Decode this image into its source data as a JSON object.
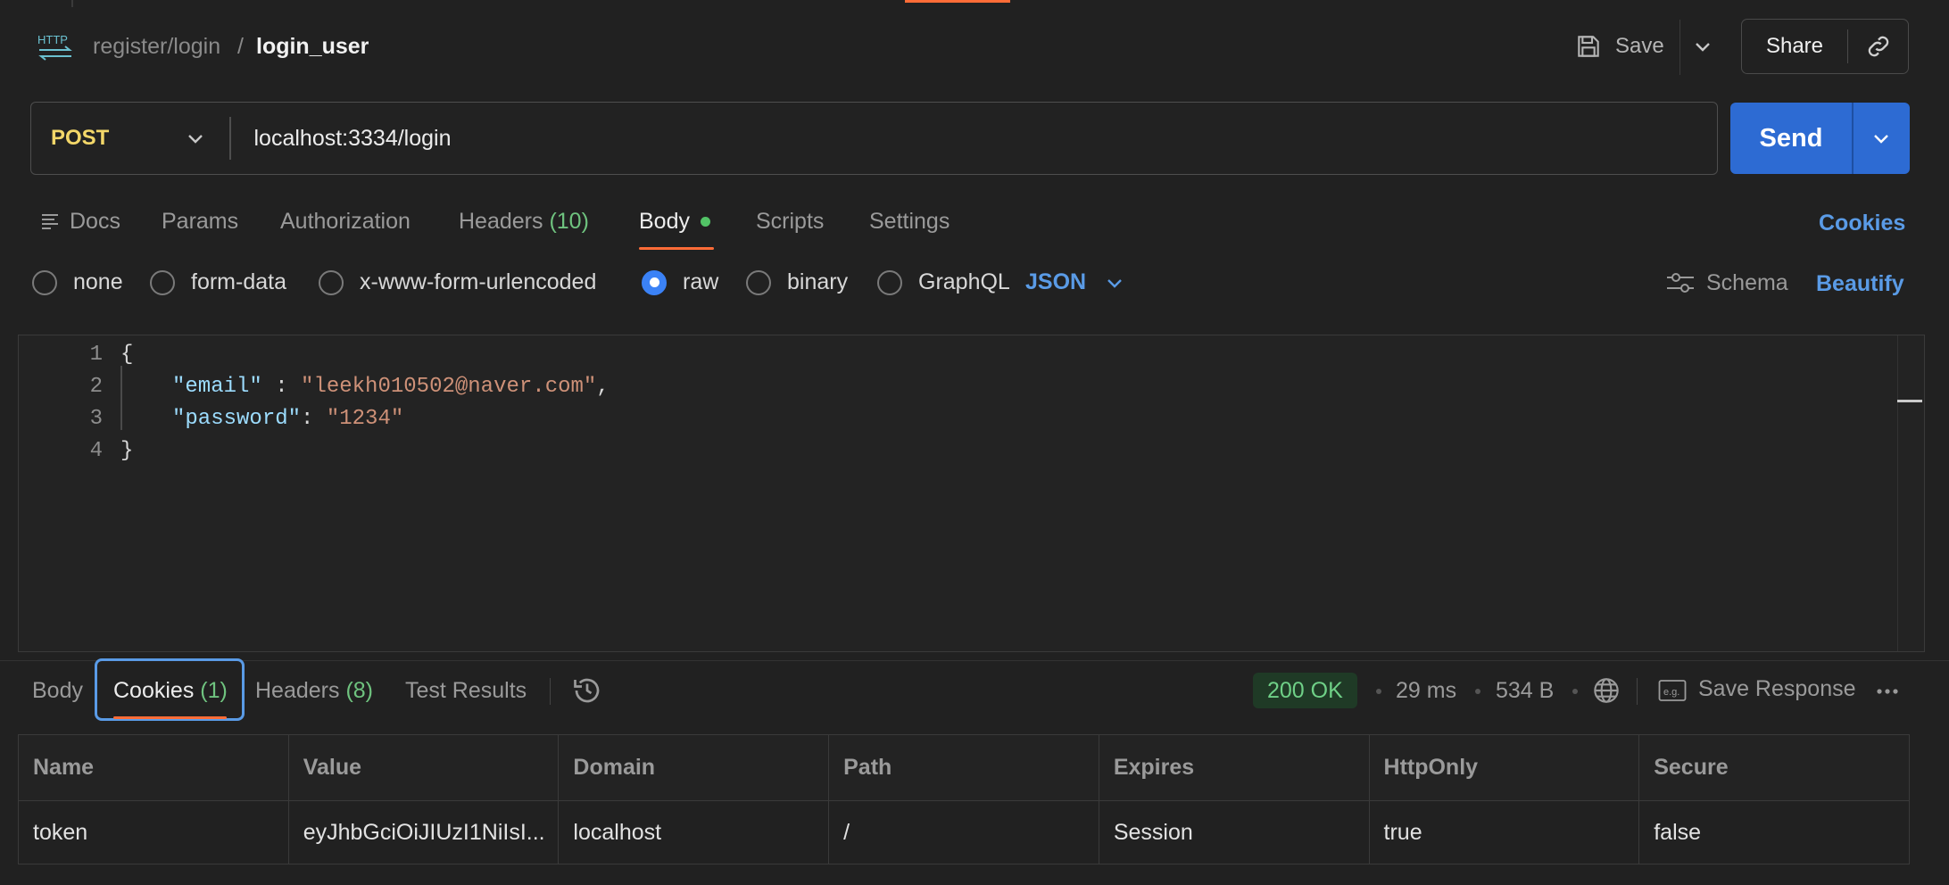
{
  "header": {
    "protocol_icon": "http-icon",
    "breadcrumb_parent": "register/login",
    "breadcrumb_separator": "/",
    "request_name": "login_user",
    "save_label": "Save",
    "share_label": "Share",
    "accent_color": "#ff6c37"
  },
  "request": {
    "method": "POST",
    "url": "localhost:3334/login",
    "send_label": "Send",
    "send_color": "#2d6bd3"
  },
  "tabs": {
    "docs": "Docs",
    "params": "Params",
    "authorization": "Authorization",
    "headers": "Headers",
    "headers_count": "(10)",
    "body": "Body",
    "scripts": "Scripts",
    "settings": "Settings",
    "active": "Body",
    "cookies_link": "Cookies"
  },
  "body_type": {
    "options": [
      "none",
      "form-data",
      "x-www-form-urlencoded",
      "raw",
      "binary",
      "GraphQL"
    ],
    "selected": "raw",
    "format": "JSON",
    "schema_label": "Schema",
    "beautify_label": "Beautify"
  },
  "editor": {
    "line_numbers": [
      "1",
      "2",
      "3",
      "4"
    ],
    "open_brace": "{",
    "close_brace": "}",
    "key1": "\"email\"",
    "sep1": " : ",
    "val1": "\"leekh010502@naver.com\"",
    "comma": ",",
    "key2": "\"password\"",
    "sep2": ": ",
    "val2": "\"1234\""
  },
  "response": {
    "tabs": {
      "body": "Body",
      "cookies": "Cookies",
      "cookies_count": "(1)",
      "headers": "Headers",
      "headers_count": "(8)",
      "test_results": "Test Results"
    },
    "active_tab": "Cookies",
    "status": "200 OK",
    "time": "29 ms",
    "size": "534 B",
    "save_response": "Save Response",
    "status_color": "#6fd087"
  },
  "cookies_table": {
    "columns": [
      "Name",
      "Value",
      "Domain",
      "Path",
      "Expires",
      "HttpOnly",
      "Secure"
    ],
    "rows": [
      [
        "token",
        "eyJhbGciOiJIUzI1NiIsI...",
        "localhost",
        "/",
        "Session",
        "true",
        "false"
      ]
    ]
  }
}
